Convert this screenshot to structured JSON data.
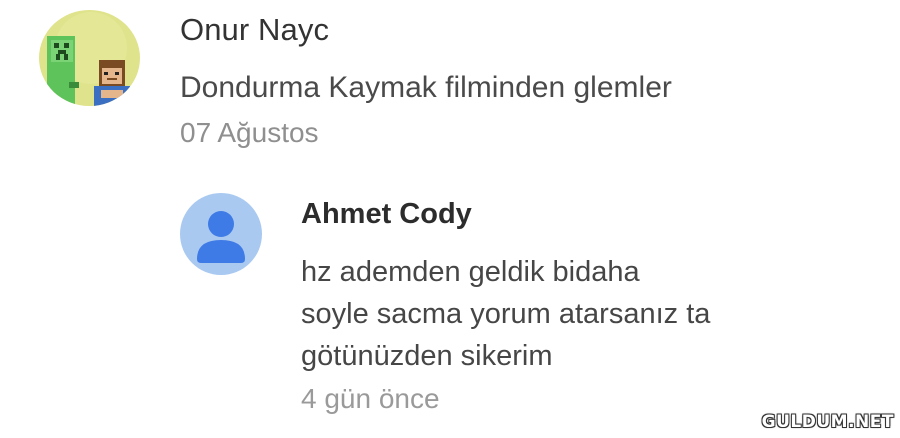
{
  "comment": {
    "author": "Onur Nayc",
    "text": "Dondurma Kaymak filminden glemler",
    "date": "07 Ağustos",
    "avatar_icon": "pixel-character-avatar-icon"
  },
  "reply": {
    "author": "Ahmet Cody",
    "lines": [
      "hz ademden geldik bidaha",
      "soyle sacma yorum atarsanız ta",
      "götünüzden sikerim"
    ],
    "time": "4 gün önce",
    "avatar_icon": "default-user-avatar-icon"
  },
  "watermark": {
    "text": "GULDUM.NET"
  },
  "colors": {
    "background": "#ffffff",
    "avatar_main_bg": "#dfe38b",
    "avatar_reply_bg": "#a9c9f1",
    "avatar_reply_figure": "#3f7be6",
    "creeper_green": "#5fc35c"
  }
}
